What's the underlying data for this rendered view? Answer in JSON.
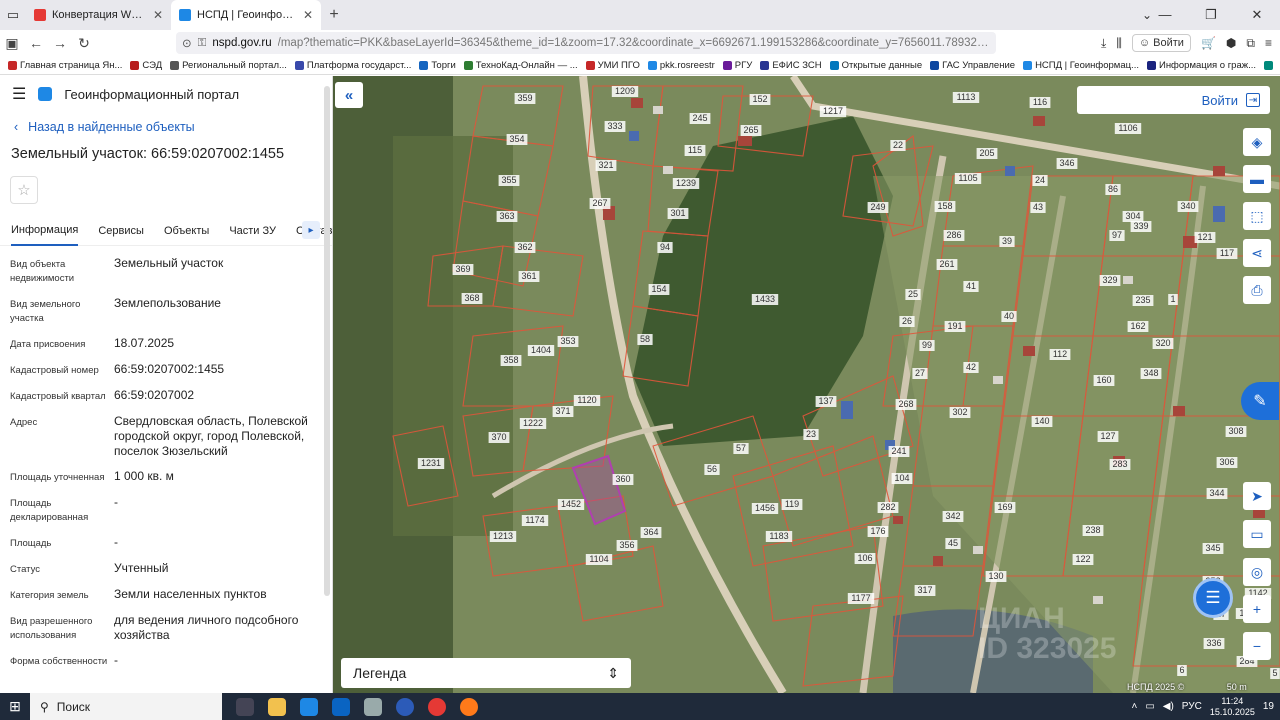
{
  "browser": {
    "tabs": [
      {
        "title": "Конвертация WORD в PDF. Док",
        "active": false
      },
      {
        "title": "НСПД | Геоинформационный",
        "active": true
      }
    ],
    "url_domain": "nspd.gov.ru",
    "url_path": "/map?thematic=PKK&baseLayerId=36345&theme_id=1&zoom=17.32&coordinate_x=6692671.199153286&coordinate_y=7656011.789326825&is_copy_url=true&ac",
    "login_label": "Войти",
    "bookmarks": [
      "Главная страница Ян...",
      "СЭД",
      "Региональный портал...",
      "Платформа государст...",
      "Торги",
      "ТехноКад-Онлайн — ...",
      "УМИ ПГО",
      "pkk.rosreestr",
      "РГУ",
      "ЕФИС ЗСН",
      "Открытые данные",
      "ГАС Управление",
      "НСПД | Геоинформац...",
      "Информация о граж..."
    ]
  },
  "panel": {
    "portal_title": "Геоинформационный портал",
    "back_label": "Назад в найденные объекты",
    "object_title": "Земельный участок: 66:59:0207002:1455",
    "tabs": [
      "Информация",
      "Сервисы",
      "Объекты",
      "Части ЗУ",
      "Состав"
    ],
    "properties": [
      {
        "key": "Вид объекта недвижимости",
        "value": "Земельный участок"
      },
      {
        "key": "Вид земельного участка",
        "value": "Землепользование"
      },
      {
        "key": "Дата присвоения",
        "value": "18.07.2025"
      },
      {
        "key": "Кадастровый номер",
        "value": "66:59:0207002:1455"
      },
      {
        "key": "Кадастровый квартал",
        "value": "66:59:0207002"
      },
      {
        "key": "Адрес",
        "value": "Свердловская область, Полевской городской округ, город Полевской, поселок Зюзельский"
      },
      {
        "key": "Площадь уточненная",
        "value": "1 000 кв. м"
      },
      {
        "key": "Площадь декларированная",
        "value": "-"
      },
      {
        "key": "Площадь",
        "value": "-"
      },
      {
        "key": "Статус",
        "value": "Учтенный"
      },
      {
        "key": "Категория земель",
        "value": "Земли населенных пунктов"
      },
      {
        "key": "Вид разрешенного использования",
        "value": "для ведения личного подсобного хозяйства"
      },
      {
        "key": "Форма собственности",
        "value": "-"
      }
    ]
  },
  "map": {
    "login_label": "Войти",
    "legend_label": "Легенда",
    "copyright": "НСПД 2025 ©",
    "scale": "50 m",
    "watermark_line1": "ЦИАН",
    "watermark_line2": "ID 323025",
    "highlighted_parcel": "1455",
    "parcel_labels": [
      "359",
      "1209",
      "333",
      "115",
      "1239",
      "301",
      "94",
      "154",
      "58",
      "245",
      "265",
      "152",
      "1217",
      "22",
      "249",
      "1433",
      "321",
      "267",
      "354",
      "355",
      "363",
      "362",
      "361",
      "369",
      "368",
      "358",
      "1404",
      "353",
      "370",
      "1222",
      "371",
      "1120",
      "1231",
      "1452",
      "360",
      "1174",
      "1213",
      "1104",
      "356",
      "364",
      "56",
      "57",
      "1456",
      "119",
      "1183",
      "137",
      "23",
      "241",
      "104",
      "282",
      "176",
      "106",
      "317",
      "342",
      "45",
      "130",
      "169",
      "122",
      "238",
      "1177",
      "268",
      "302",
      "27",
      "99",
      "26",
      "191",
      "42",
      "140",
      "112",
      "160",
      "162",
      "320",
      "348",
      "127",
      "283",
      "308",
      "306",
      "344",
      "345",
      "252",
      "17",
      "336",
      "1113",
      "116",
      "1106",
      "1171",
      "1105",
      "205",
      "24",
      "346",
      "86",
      "304",
      "339",
      "340",
      "121",
      "97",
      "329",
      "235",
      "117",
      "158",
      "286",
      "261",
      "25",
      "41",
      "40",
      "39",
      "43",
      "1",
      "6",
      "5",
      "284",
      "1141",
      "1142"
    ]
  },
  "taskbar": {
    "search_label": "Поиск",
    "lang": "РУС",
    "time": "11:24",
    "date": "15.10.2025",
    "notif_count": "19"
  },
  "colors": {
    "accent": "#1e5fbf",
    "parcel_border": "#e0553a",
    "highlight": "#b03fb0"
  }
}
